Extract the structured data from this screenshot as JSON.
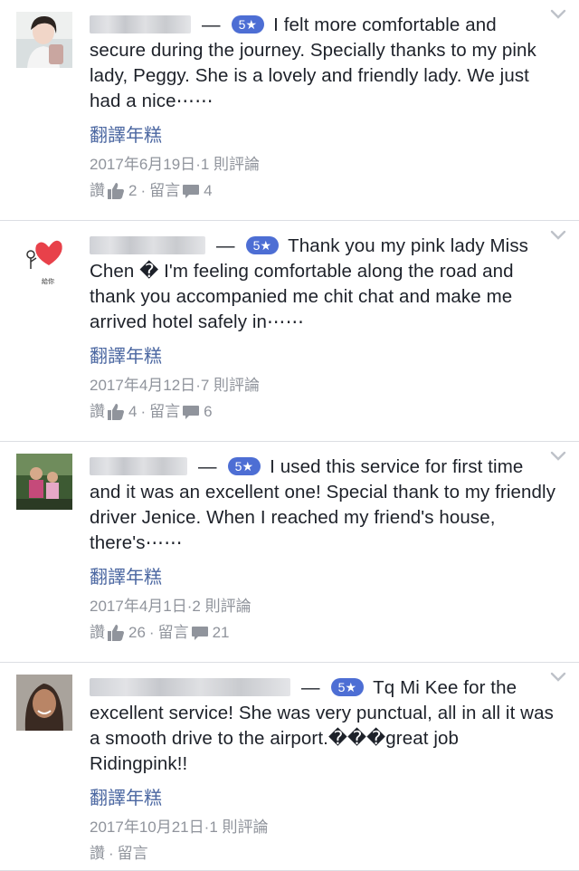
{
  "reviews": [
    {
      "rating": "5★",
      "text": "I felt more comfortable and secure during the journey. Specially thanks to my pink lady, Peggy. She is a lovely and friendly lady. We just had a nice⋯⋯",
      "translate": "翻譯年糕",
      "date": "2017年6月19日",
      "comments_count": "1 則評論",
      "like_label": "讚",
      "like_count": "2",
      "comment_label": "留言",
      "comment_count": "4"
    },
    {
      "rating": "5★",
      "text": "Thank you my pink lady Miss Chen � I'm feeling comfortable along the road and thank you accompanied me chit chat and make me arrived hotel safely in⋯⋯",
      "translate": "翻譯年糕",
      "date": "2017年4月12日",
      "comments_count": "7 則評論",
      "like_label": "讚",
      "like_count": "4",
      "comment_label": "留言",
      "comment_count": "6",
      "avatar_caption": "給你"
    },
    {
      "rating": "5★",
      "text": "I used this service for first time and it was an excellent one! Special thank to my friendly driver Jenice. When I reached my friend's house, there's⋯⋯",
      "translate": "翻譯年糕",
      "date": "2017年4月1日",
      "comments_count": "2 則評論",
      "like_label": "讚",
      "like_count": "26",
      "comment_label": "留言",
      "comment_count": "21"
    },
    {
      "rating": "5★",
      "text": "Tq Mi Kee for the excellent service! She was very punctual, all in all it was a smooth drive to the airport.���great job Ridingpink!!",
      "translate": "翻譯年糕",
      "date": "2017年10月21日",
      "comments_count": "1 則評論",
      "like_label": "讚",
      "comment_label": "留言"
    }
  ],
  "separators": {
    "dash": "—",
    "dot": "·"
  },
  "colors": {
    "link": "#4b67a1",
    "badge": "#4d6ed4",
    "meta": "#90949c",
    "text": "#1d2129"
  }
}
